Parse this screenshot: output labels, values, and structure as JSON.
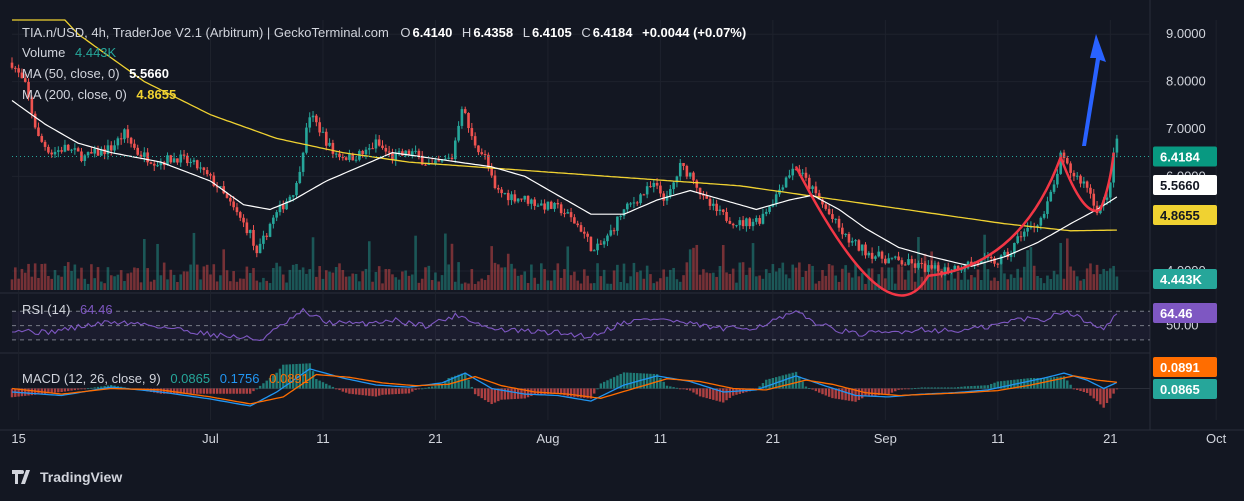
{
  "header": {
    "symbol": "TIA.n/USD, 4h, TraderJoe V2.1 (Arbitrum) | GeckoTerminal.com",
    "o_label": "O",
    "o_value": "6.4140",
    "h_label": "H",
    "h_value": "6.4358",
    "l_label": "L",
    "l_value": "6.4105",
    "c_label": "C",
    "c_value": "6.4184",
    "change": "+0.0044 (+0.07%)",
    "volume_label": "Volume",
    "volume_value": "4.443K",
    "ma50_label": "MA (50, close, 0)",
    "ma50_value": "5.5660",
    "ma200_label": "MA (200, close, 0)",
    "ma200_value": "4.8655"
  },
  "rsi": {
    "label": "RSI (14)",
    "value": "64.46",
    "axis_label": "50.00"
  },
  "macd": {
    "label": "MACD (12, 26, close, 9)",
    "macd_value": "0.0865",
    "hist_value": "0.1756",
    "signal_value": "0.0891"
  },
  "badges": {
    "price": "6.4184",
    "ma50": "5.5660",
    "ma200": "4.8655",
    "volume": "4.443K",
    "rsi": "64.46",
    "signal": "0.0891",
    "macd": "0.0865"
  },
  "brand": {
    "name": "TradingView"
  },
  "colors": {
    "bg": "#131722",
    "up": "#26a69a",
    "down": "#ef5350",
    "ma50": "#ffffff",
    "ma200": "#f0d231",
    "rsi": "#7e57c2",
    "macd": "#2196f3",
    "signal": "#ff6d00",
    "arrow": "#2962ff",
    "cup": "#f23645"
  },
  "chart_data": {
    "type": "candlestick",
    "title": "TIA.n/USD, 4h, TraderJoe V2.1 (Arbitrum) | GeckoTerminal.com",
    "x_ticks": [
      "15",
      "Jul",
      "11",
      "21",
      "Aug",
      "11",
      "21",
      "Sep",
      "11",
      "21",
      "Oct"
    ],
    "y_ticks": [
      "9.0000",
      "8.0000",
      "7.0000",
      "6.0000",
      "4.0000"
    ],
    "ylim": [
      3.6,
      9.3
    ],
    "price_path": [
      [
        0,
        8.4
      ],
      [
        4,
        7.9
      ],
      [
        8,
        6.8
      ],
      [
        12,
        6.5
      ],
      [
        16,
        6.6
      ],
      [
        22,
        6.4
      ],
      [
        30,
        6.6
      ],
      [
        34,
        6.9
      ],
      [
        38,
        6.5
      ],
      [
        44,
        6.3
      ],
      [
        50,
        6.4
      ],
      [
        56,
        6.2
      ],
      [
        62,
        5.8
      ],
      [
        66,
        5.4
      ],
      [
        72,
        4.8
      ],
      [
        74,
        4.3
      ],
      [
        78,
        5.0
      ],
      [
        82,
        5.4
      ],
      [
        86,
        5.8
      ],
      [
        88,
        6.6
      ],
      [
        90,
        7.3
      ],
      [
        93,
        7.0
      ],
      [
        97,
        6.5
      ],
      [
        102,
        6.4
      ],
      [
        107,
        6.5
      ],
      [
        110,
        6.7
      ],
      [
        115,
        6.4
      ],
      [
        121,
        6.5
      ],
      [
        127,
        6.2
      ],
      [
        133,
        6.4
      ],
      [
        136,
        7.5
      ],
      [
        139,
        6.8
      ],
      [
        143,
        6.4
      ],
      [
        146,
        5.7
      ],
      [
        150,
        5.6
      ],
      [
        156,
        5.5
      ],
      [
        160,
        5.4
      ],
      [
        166,
        5.3
      ],
      [
        172,
        4.9
      ],
      [
        176,
        4.4
      ],
      [
        180,
        4.7
      ],
      [
        184,
        5.2
      ],
      [
        190,
        5.6
      ],
      [
        194,
        5.8
      ],
      [
        198,
        5.5
      ],
      [
        202,
        6.2
      ],
      [
        206,
        6.0
      ],
      [
        209,
        5.5
      ],
      [
        214,
        5.2
      ],
      [
        220,
        5.0
      ],
      [
        226,
        5.1
      ],
      [
        231,
        5.6
      ],
      [
        234,
        6.0
      ],
      [
        237,
        6.2
      ],
      [
        241,
        5.8
      ],
      [
        246,
        5.3
      ],
      [
        252,
        4.7
      ],
      [
        256,
        4.5
      ],
      [
        262,
        4.3
      ],
      [
        268,
        4.2
      ],
      [
        274,
        4.1
      ],
      [
        280,
        4.0
      ],
      [
        286,
        4.1
      ],
      [
        292,
        4.2
      ],
      [
        298,
        4.2
      ],
      [
        302,
        4.4
      ],
      [
        305,
        4.8
      ],
      [
        308,
        4.9
      ],
      [
        312,
        5.2
      ],
      [
        315,
        5.8
      ],
      [
        317,
        6.4
      ],
      [
        320,
        6.1
      ],
      [
        325,
        5.8
      ],
      [
        328,
        5.3
      ],
      [
        331,
        5.5
      ],
      [
        333,
        6.4
      ],
      [
        334,
        6.8
      ]
    ],
    "ma50_path": [
      [
        0,
        7.6
      ],
      [
        10,
        7.1
      ],
      [
        20,
        6.7
      ],
      [
        30,
        6.5
      ],
      [
        45,
        6.3
      ],
      [
        60,
        5.9
      ],
      [
        70,
        5.4
      ],
      [
        78,
        5.3
      ],
      [
        85,
        5.5
      ],
      [
        95,
        5.9
      ],
      [
        105,
        6.2
      ],
      [
        115,
        6.5
      ],
      [
        125,
        6.4
      ],
      [
        135,
        6.3
      ],
      [
        145,
        6.2
      ],
      [
        155,
        6.0
      ],
      [
        165,
        5.6
      ],
      [
        175,
        5.2
      ],
      [
        185,
        5.2
      ],
      [
        195,
        5.5
      ],
      [
        205,
        5.7
      ],
      [
        215,
        5.5
      ],
      [
        225,
        5.3
      ],
      [
        235,
        5.5
      ],
      [
        242,
        5.6
      ],
      [
        250,
        5.3
      ],
      [
        258,
        4.9
      ],
      [
        268,
        4.5
      ],
      [
        278,
        4.3
      ],
      [
        290,
        4.1
      ],
      [
        300,
        4.3
      ],
      [
        310,
        4.6
      ],
      [
        320,
        5.0
      ],
      [
        328,
        5.3
      ],
      [
        334,
        5.566
      ]
    ],
    "ma200_path": [
      [
        0,
        10.5
      ],
      [
        20,
        9.0
      ],
      [
        40,
        8.0
      ],
      [
        60,
        7.3
      ],
      [
        80,
        6.8
      ],
      [
        100,
        6.5
      ],
      [
        120,
        6.3
      ],
      [
        140,
        6.2
      ],
      [
        160,
        6.1
      ],
      [
        180,
        6.0
      ],
      [
        200,
        5.9
      ],
      [
        220,
        5.8
      ],
      [
        240,
        5.6
      ],
      [
        260,
        5.4
      ],
      [
        280,
        5.2
      ],
      [
        300,
        5.0
      ],
      [
        320,
        4.85
      ],
      [
        334,
        4.8655
      ]
    ],
    "rsi_ylim": [
      20,
      90
    ],
    "rsi_levels": [
      70,
      50,
      30
    ],
    "rsi_path": [
      [
        0,
        45
      ],
      [
        10,
        40
      ],
      [
        20,
        48
      ],
      [
        30,
        55
      ],
      [
        40,
        52
      ],
      [
        50,
        45
      ],
      [
        60,
        38
      ],
      [
        70,
        33
      ],
      [
        75,
        30
      ],
      [
        80,
        45
      ],
      [
        88,
        70
      ],
      [
        95,
        55
      ],
      [
        105,
        52
      ],
      [
        115,
        58
      ],
      [
        125,
        50
      ],
      [
        135,
        65
      ],
      [
        145,
        45
      ],
      [
        155,
        42
      ],
      [
        165,
        40
      ],
      [
        175,
        35
      ],
      [
        185,
        55
      ],
      [
        195,
        60
      ],
      [
        205,
        52
      ],
      [
        215,
        45
      ],
      [
        225,
        48
      ],
      [
        237,
        68
      ],
      [
        245,
        50
      ],
      [
        255,
        38
      ],
      [
        265,
        40
      ],
      [
        275,
        45
      ],
      [
        285,
        42
      ],
      [
        295,
        48
      ],
      [
        305,
        60
      ],
      [
        312,
        58
      ],
      [
        318,
        72
      ],
      [
        325,
        55
      ],
      [
        330,
        48
      ],
      [
        334,
        64.46
      ]
    ],
    "macd_ylim": [
      -0.45,
      0.45
    ],
    "macd_path": [
      [
        0,
        -0.05
      ],
      [
        15,
        -0.1
      ],
      [
        30,
        0.02
      ],
      [
        45,
        -0.05
      ],
      [
        60,
        -0.15
      ],
      [
        72,
        -0.25
      ],
      [
        80,
        -0.05
      ],
      [
        90,
        0.28
      ],
      [
        100,
        0.15
      ],
      [
        110,
        0.05
      ],
      [
        120,
        0.02
      ],
      [
        130,
        0.08
      ],
      [
        137,
        0.22
      ],
      [
        145,
        0.0
      ],
      [
        155,
        -0.08
      ],
      [
        165,
        -0.1
      ],
      [
        175,
        -0.18
      ],
      [
        185,
        0.05
      ],
      [
        195,
        0.18
      ],
      [
        205,
        0.1
      ],
      [
        215,
        -0.05
      ],
      [
        225,
        -0.02
      ],
      [
        237,
        0.18
      ],
      [
        245,
        0.05
      ],
      [
        255,
        -0.1
      ],
      [
        265,
        -0.12
      ],
      [
        275,
        -0.08
      ],
      [
        285,
        -0.06
      ],
      [
        295,
        -0.02
      ],
      [
        305,
        0.08
      ],
      [
        312,
        0.15
      ],
      [
        318,
        0.22
      ],
      [
        325,
        0.12
      ],
      [
        330,
        0.0
      ],
      [
        334,
        0.0865
      ]
    ],
    "signal_path": [
      [
        0,
        0.0
      ],
      [
        15,
        -0.08
      ],
      [
        30,
        0.0
      ],
      [
        45,
        -0.02
      ],
      [
        60,
        -0.12
      ],
      [
        72,
        -0.22
      ],
      [
        82,
        -0.12
      ],
      [
        92,
        0.2
      ],
      [
        102,
        0.16
      ],
      [
        112,
        0.08
      ],
      [
        122,
        0.04
      ],
      [
        132,
        0.06
      ],
      [
        140,
        0.17
      ],
      [
        148,
        0.04
      ],
      [
        158,
        -0.05
      ],
      [
        168,
        -0.08
      ],
      [
        178,
        -0.14
      ],
      [
        188,
        0.0
      ],
      [
        198,
        0.14
      ],
      [
        208,
        0.1
      ],
      [
        218,
        0.0
      ],
      [
        228,
        -0.02
      ],
      [
        240,
        0.12
      ],
      [
        248,
        0.06
      ],
      [
        258,
        -0.06
      ],
      [
        268,
        -0.1
      ],
      [
        278,
        -0.08
      ],
      [
        288,
        -0.06
      ],
      [
        298,
        -0.03
      ],
      [
        308,
        0.05
      ],
      [
        315,
        0.12
      ],
      [
        321,
        0.18
      ],
      [
        328,
        0.12
      ],
      [
        334,
        0.0891
      ]
    ]
  }
}
